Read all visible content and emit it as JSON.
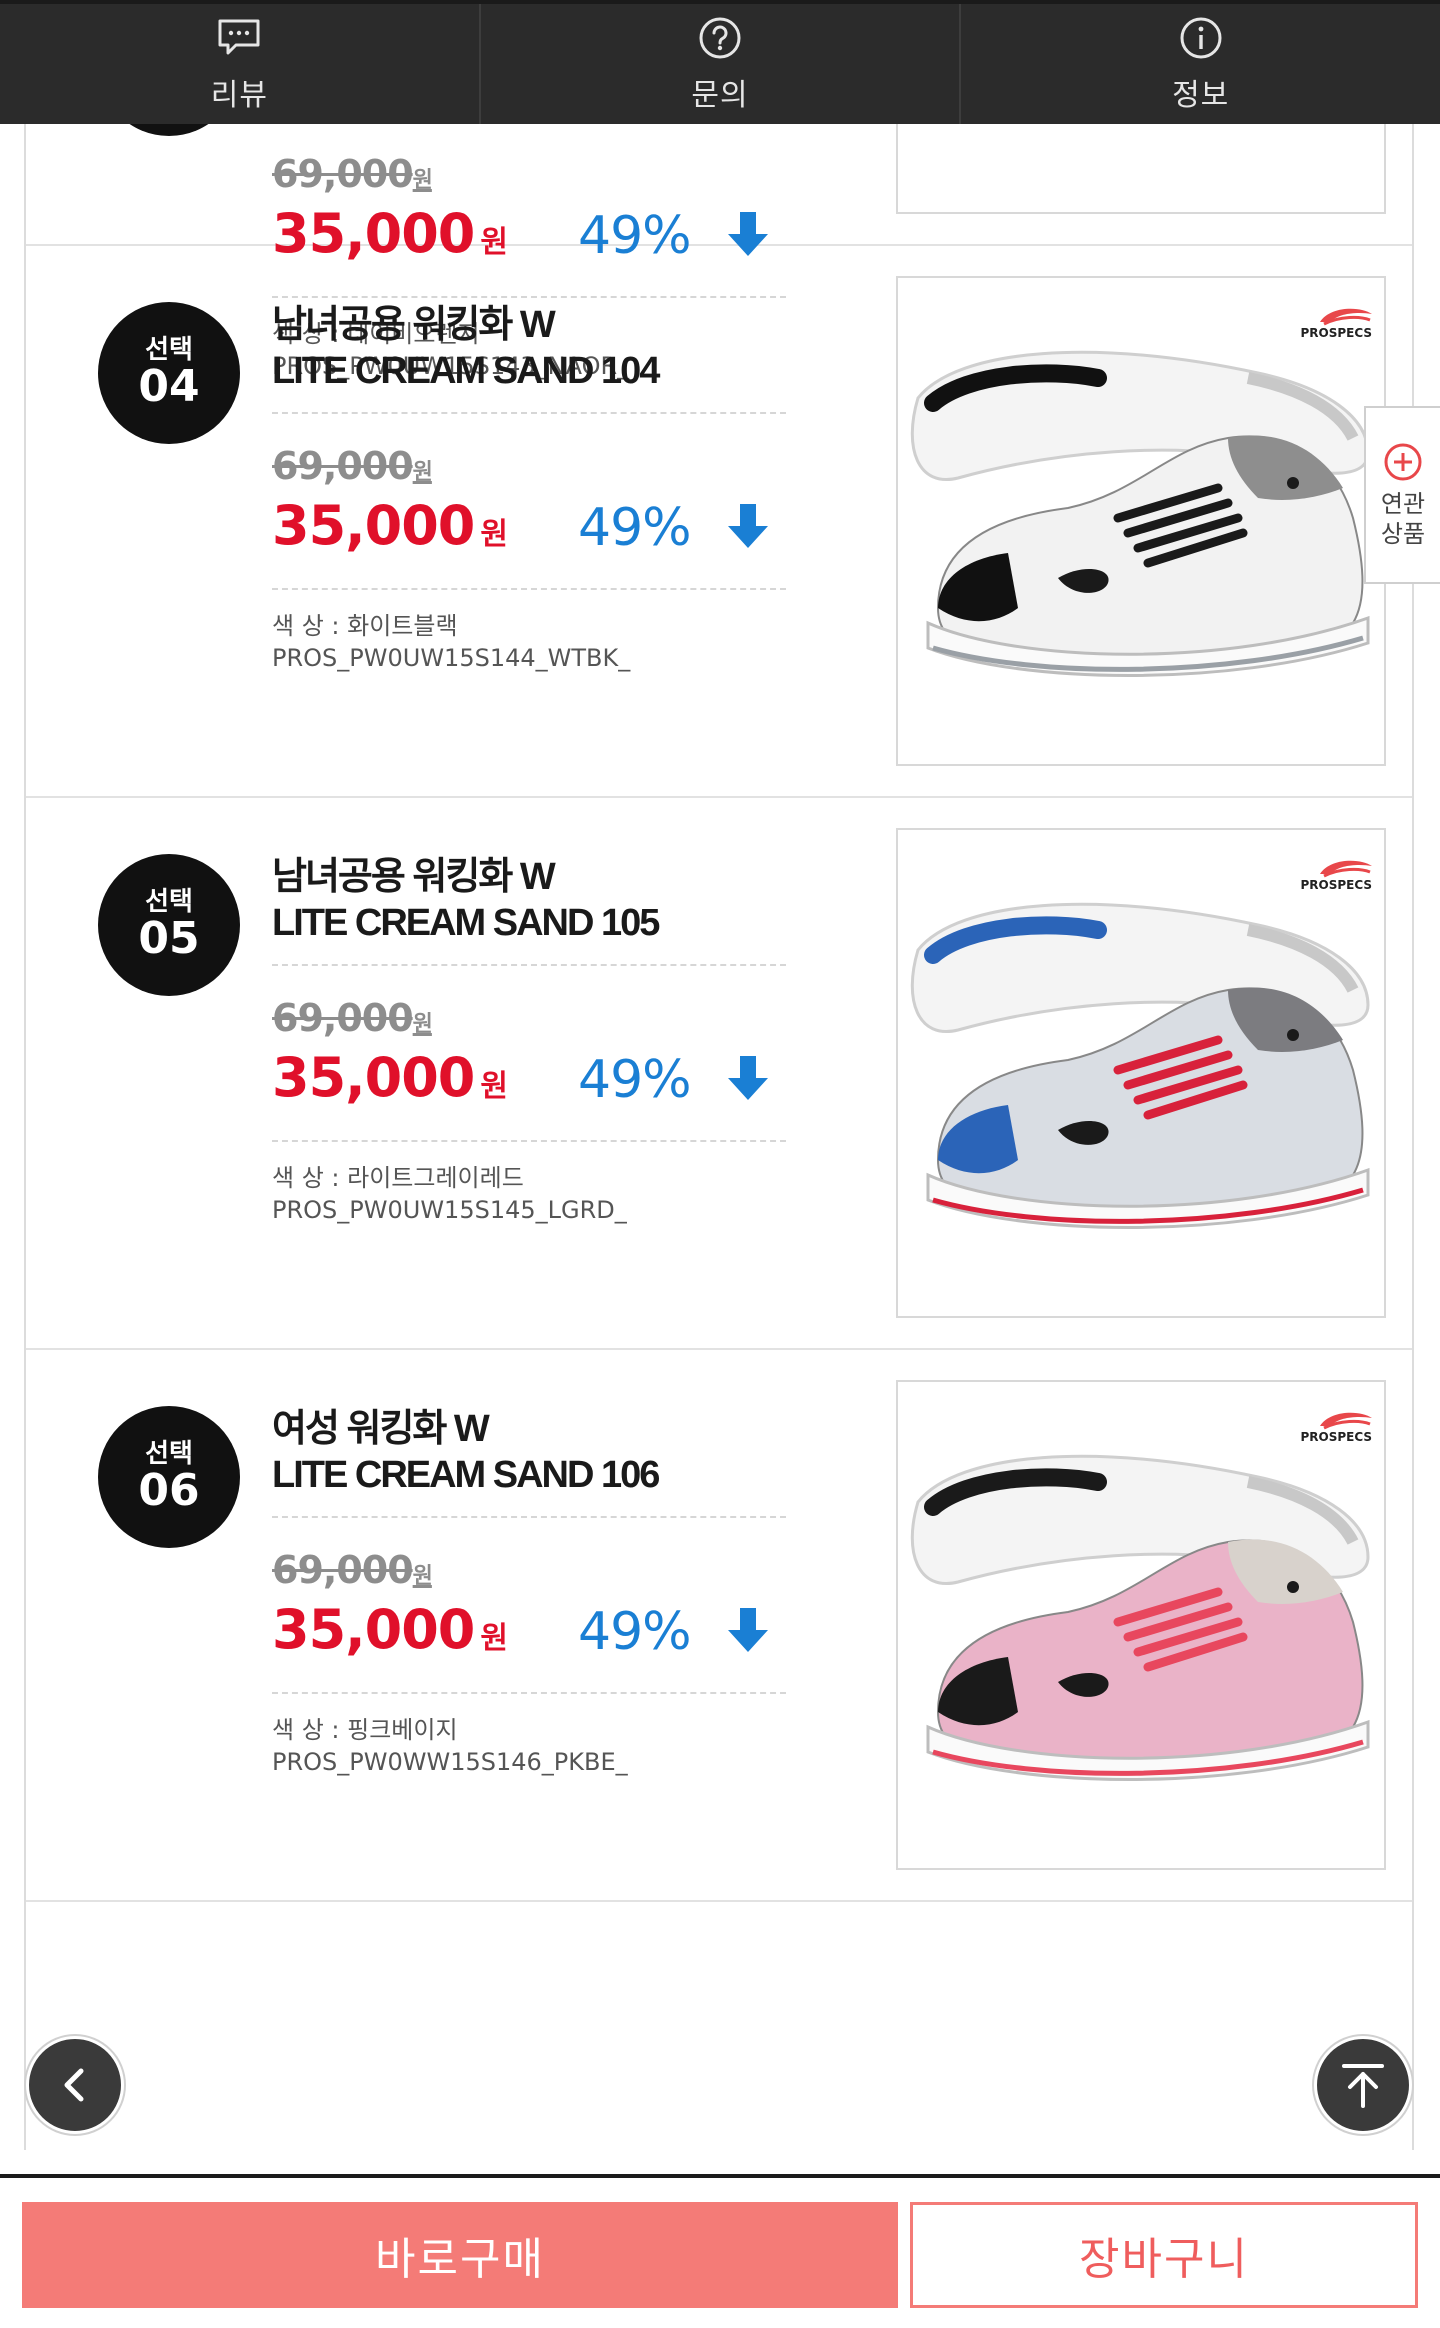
{
  "tabs": [
    {
      "label": "리뷰",
      "icon": "chat-bubble-icon"
    },
    {
      "label": "문의",
      "icon": "question-circle-icon"
    },
    {
      "label": "정보",
      "icon": "info-circle-icon"
    }
  ],
  "related_tab": {
    "label": "연관\n상품",
    "icon": "plus-circle-icon"
  },
  "brand_logo": "PROSPECS",
  "items": [
    {
      "badge_label": "",
      "badge_number": "",
      "title_line1": "",
      "title_line2": "",
      "original_price": "69,000",
      "original_unit": "원",
      "sale_price": "35,000",
      "sale_unit": "원",
      "discount": "49%",
      "color_label": "색  상 : 네이비오렌지",
      "product_code": "PROS_PW0UW15S143_NAOR_",
      "shoe_colors": {
        "upper": "#2c4f8c",
        "accent": "#ef5a3c",
        "lace": "#ffffff",
        "heel": "#1f3766"
      }
    },
    {
      "badge_label": "선택",
      "badge_number": "04",
      "title_line1": "남녀공용 워킹화 W",
      "title_line2": "LITE CREAM SAND 104",
      "original_price": "69,000",
      "original_unit": "원",
      "sale_price": "35,000",
      "sale_unit": "원",
      "discount": "49%",
      "color_label": "색  상 : 화이트블랙",
      "product_code": "PROS_PW0UW15S144_WTBK_",
      "shoe_colors": {
        "upper": "#f2f2f2",
        "accent": "#8e8e8e",
        "lace": "#1a1a1a",
        "heel": "#111111"
      }
    },
    {
      "badge_label": "선택",
      "badge_number": "05",
      "title_line1": "남녀공용 워킹화 W",
      "title_line2": "LITE CREAM SAND 105",
      "original_price": "69,000",
      "original_unit": "원",
      "sale_price": "35,000",
      "sale_unit": "원",
      "discount": "49%",
      "color_label": "색  상 : 라이트그레이레드",
      "product_code": "PROS_PW0UW15S145_LGRD_",
      "shoe_colors": {
        "upper": "#d9dde3",
        "accent": "#7c7c80",
        "lace": "#d8213b",
        "heel": "#2b64b8"
      }
    },
    {
      "badge_label": "선택",
      "badge_number": "06",
      "title_line1": "여성 워킹화 W",
      "title_line2": "LITE CREAM SAND 106",
      "original_price": "69,000",
      "original_unit": "원",
      "sale_price": "35,000",
      "sale_unit": "원",
      "discount": "49%",
      "color_label": "색  상 : 핑크베이지",
      "product_code": "PROS_PW0WW15S146_PKBE_",
      "shoe_colors": {
        "upper": "#eab3c8",
        "accent": "#d8d2cc",
        "lace": "#e8475e",
        "heel": "#1a1a1a"
      }
    }
  ],
  "buttons": {
    "buy": "바로구매",
    "cart": "장바구니"
  },
  "colors": {
    "sale": "#e0102a",
    "discount": "#1a7fd4",
    "buy_bg": "#f47b77",
    "topbar": "#2b2b2b"
  }
}
